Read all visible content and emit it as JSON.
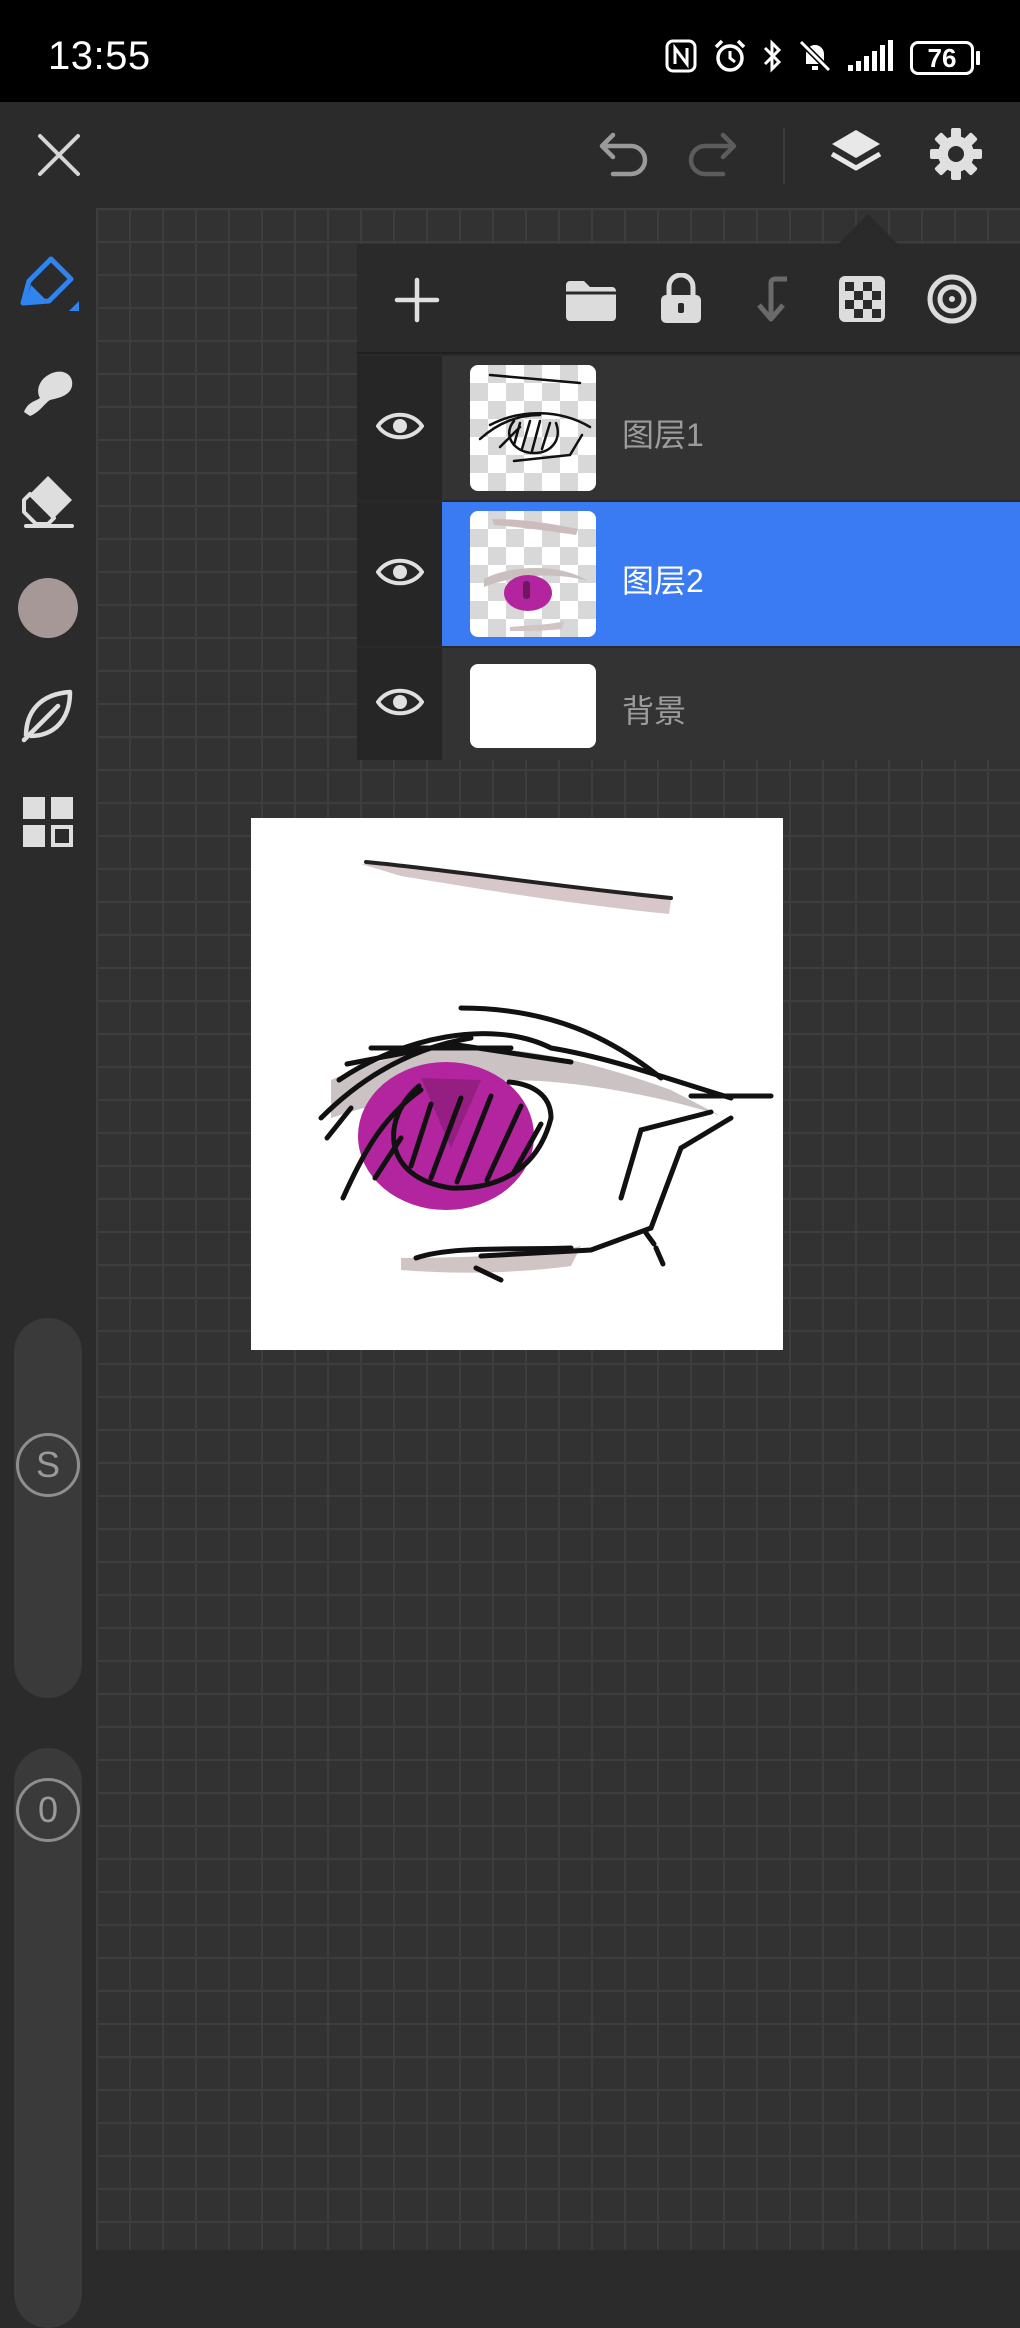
{
  "status_bar": {
    "time": "13:55",
    "battery": "76",
    "icons": [
      "nfc-icon",
      "alarm-icon",
      "bluetooth-icon",
      "mute-icon",
      "signal-icon"
    ]
  },
  "top_bar": {
    "icons": [
      "close-icon",
      "undo-icon",
      "redo-icon",
      "layers-icon",
      "settings-icon"
    ]
  },
  "left_toolbar": {
    "tools": [
      "pen-icon",
      "smudge-icon",
      "eraser-icon",
      "color-swatch",
      "leaf-brush-icon",
      "grid-menu-icon"
    ],
    "current_color": "#a69896",
    "size_slider_label": "S",
    "opacity_slider_label": "0"
  },
  "layers_panel": {
    "toolbar_icons": [
      "add-layer-icon",
      "folder-icon",
      "lock-icon",
      "merge-down-icon",
      "transparency-icon",
      "target-icon"
    ],
    "layers": [
      {
        "name": "图层1",
        "visible": true,
        "selected": false
      },
      {
        "name": "图层2",
        "visible": true,
        "selected": true
      },
      {
        "name": "背景",
        "visible": true,
        "selected": false
      }
    ]
  },
  "colors": {
    "accent": "#3a7af2",
    "iris": "#b3259e"
  }
}
